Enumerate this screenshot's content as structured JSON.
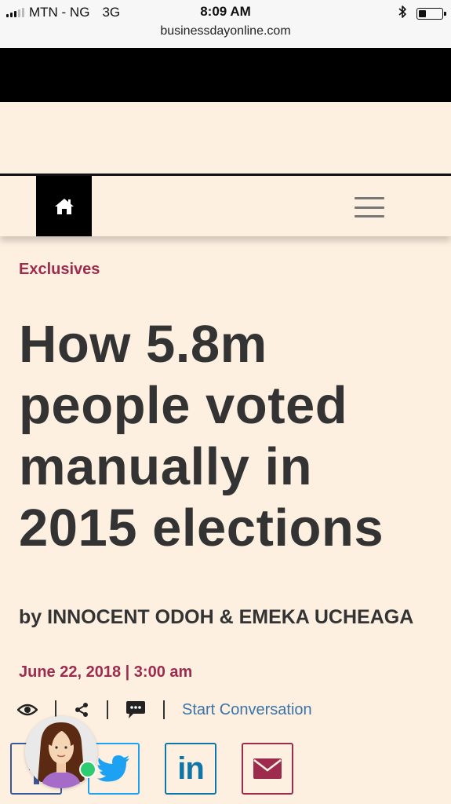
{
  "status_bar": {
    "carrier": "MTN - NG",
    "network": "3G",
    "time": "8:09 AM",
    "url": "businessdayonline.com",
    "battery_level": 0.35
  },
  "nav": {
    "home_icon": "home-icon",
    "menu_icon": "hamburger-menu-icon"
  },
  "article": {
    "category": "Exclusives",
    "headline": "How 5.8m people voted manually in 2015 elections",
    "byline": "by INNOCENT ODOH & EMEKA UCHEAGA",
    "date": "June 22, 2018 | 3:00 am"
  },
  "actions": {
    "icons": [
      "eye-icon",
      "share-icon",
      "comment-icon"
    ],
    "start_conversation": "Start Conversation"
  },
  "share": {
    "buttons": [
      "facebook-icon",
      "twitter-icon",
      "linkedin-icon",
      "email-icon"
    ],
    "linkedin_label": "in"
  },
  "colors": {
    "background": "#fdf0e1",
    "accent": "#9c2b4d",
    "link": "#3a73a8",
    "online": "#2ecc71"
  }
}
